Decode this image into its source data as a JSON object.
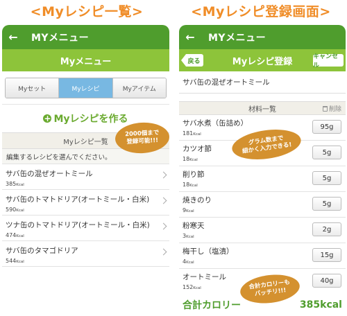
{
  "left_caption": "<Myレシピ一覧>",
  "right_caption": "<Myレシピ登録画面>",
  "colors": {
    "green_dark": "#4f9d2d",
    "green_light": "#8dc43a",
    "tab_active": "#78b8e2",
    "accent": "#f08d28",
    "bubble": "#d4912f"
  },
  "left": {
    "appbar": {
      "back_icon": "←",
      "title": "MYメニュー"
    },
    "subheader": "Myメニュー",
    "tabs": [
      {
        "label": "Myセット",
        "active": false
      },
      {
        "label": "Myレシピ",
        "active": true
      },
      {
        "label": "Myアイテム",
        "active": false
      }
    ],
    "create_button": "Myレシピを作る",
    "section_title": "Myレシピ一覧",
    "hint": "編集するレシピを選んでください。",
    "recipes": [
      {
        "name": "サバ缶の混ぜオートミール",
        "kcal": "385",
        "unit": "Kcal"
      },
      {
        "name": "サバ缶のトマトドリア(オートミール・白米)",
        "kcal": "590",
        "unit": "Kcal"
      },
      {
        "name": "ツナ缶のトマトドリア(オートミール・白米)",
        "kcal": "474",
        "unit": "Kcal"
      },
      {
        "name": "サバ缶のタマゴドリア",
        "kcal": "544",
        "unit": "Kcal"
      }
    ],
    "bubble": {
      "line1": "2000個まで",
      "line2": "登録可能!!!"
    }
  },
  "right": {
    "appbar": {
      "back_icon": "←",
      "title": "MYメニュー"
    },
    "back_button": "戻る",
    "subheader": "Myレシピ登録",
    "cancel_button": "キャンセル",
    "recipe_name": "サバ缶の混ぜオートミール",
    "materials_title": "材料一覧",
    "delete_label": "削除",
    "ingredients": [
      {
        "name": "サバ水煮（缶詰め）",
        "kcal": "181",
        "unit": "Kcal",
        "gram": "95g"
      },
      {
        "name": "カツオ節",
        "kcal": "18",
        "unit": "Kcal",
        "gram": "5g"
      },
      {
        "name": "削り節",
        "kcal": "18",
        "unit": "Kcal",
        "gram": "5g"
      },
      {
        "name": "焼きのり",
        "kcal": "9",
        "unit": "Kcal",
        "gram": "5g"
      },
      {
        "name": "粉寒天",
        "kcal": "3",
        "unit": "Kcal",
        "gram": "2g"
      },
      {
        "name": "梅干し（塩漬）",
        "kcal": "4",
        "unit": "Kcal",
        "gram": "15g"
      },
      {
        "name": "オートミール",
        "kcal": "152",
        "unit": "Kcal",
        "gram": "40g"
      }
    ],
    "total_label": "合計カロリー",
    "total_value": "385kcal",
    "bubble_gram": {
      "line1": "グラム数まで",
      "line2": "細かく入力できる!"
    },
    "bubble_total": {
      "line1": "合計カロリーも",
      "line2": "バッチリ!!!"
    }
  }
}
